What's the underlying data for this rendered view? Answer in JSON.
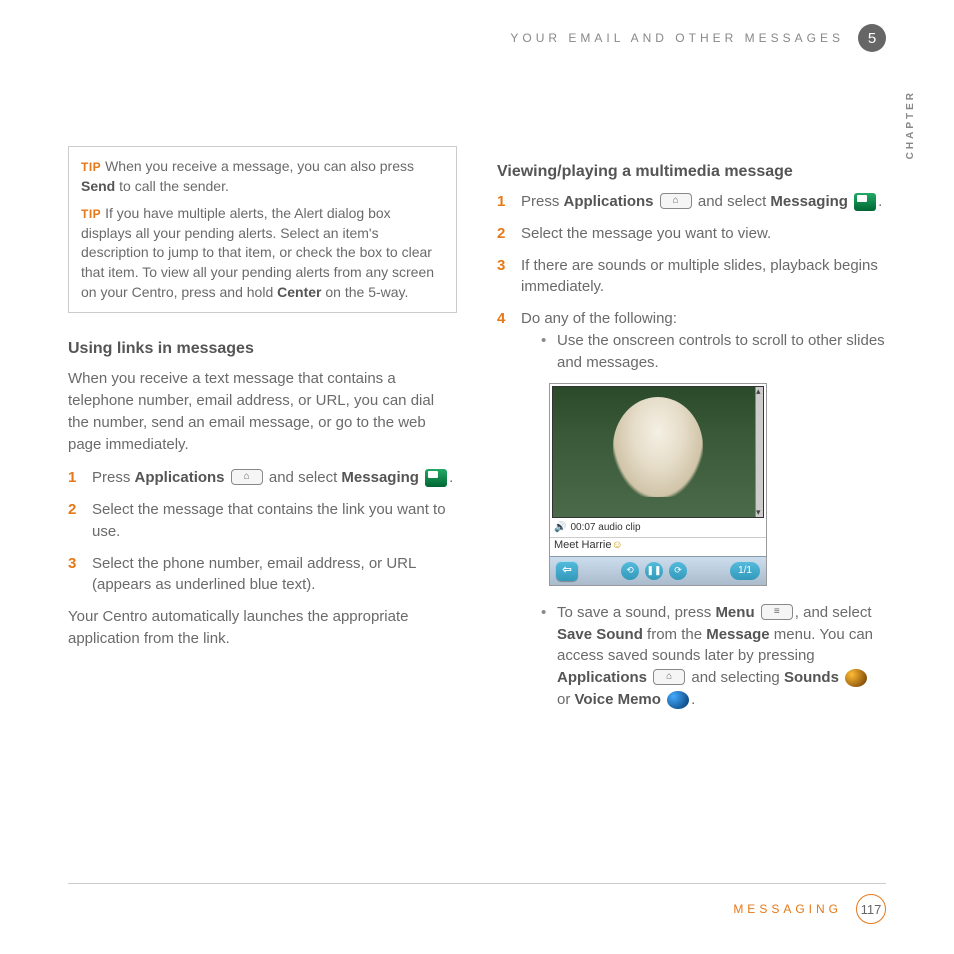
{
  "header": {
    "title": "YOUR EMAIL AND OTHER MESSAGES",
    "chapter_number": "5",
    "chapter_label": "CHAPTER"
  },
  "tips": {
    "label": "TIP",
    "tip1_a": "When you receive a message, you can also press ",
    "tip1_bold": "Send",
    "tip1_b": " to call the sender.",
    "tip2_a": "If you have multiple alerts, the Alert dialog box displays all your pending alerts. Select an item's description to jump to that item, or check the box to clear that item. To view all your pending alerts from any screen on your Centro, press and hold ",
    "tip2_bold": "Center",
    "tip2_b": " on the 5-way."
  },
  "left": {
    "section_title": "Using links in messages",
    "intro": "When you receive a text message that contains a telephone number, email address, or URL, you can dial the number, send an email message, or go to the web page immediately.",
    "step1_a": "Press ",
    "step1_b1": "Applications",
    "step1_c": " and select ",
    "step1_b2": "Messaging",
    "step1_d": ".",
    "step2": "Select the message that contains the link you want to use.",
    "step3": "Select the phone number, email address, or URL (appears as underlined blue text).",
    "outro": "Your Centro automatically launches the appropriate application from the link."
  },
  "right": {
    "section_title": "Viewing/playing a multimedia message",
    "step1_a": "Press ",
    "step1_b1": "Applications",
    "step1_c": " and select ",
    "step1_b2": "Messaging",
    "step1_d": ".",
    "step2": "Select the message you want to view.",
    "step3": "If there are sounds or multiple slides, playback begins immediately.",
    "step4": "Do any of the following:",
    "bullet1": "Use the onscreen controls to scroll to other slides and messages.",
    "bullet2_a": "To save a sound, press ",
    "bullet2_b1": "Menu",
    "bullet2_b": ", and select ",
    "bullet2_b2": "Save Sound",
    "bullet2_c": " from the ",
    "bullet2_b3": "Message",
    "bullet2_d": " menu. You can access saved sounds later by pressing ",
    "bullet2_b4": "Applications",
    "bullet2_e": " and selecting ",
    "bullet2_b5": "Sounds",
    "bullet2_f": " or ",
    "bullet2_b6": "Voice Memo",
    "bullet2_g": "."
  },
  "screenshot": {
    "audio_meta": "00:07 audio clip",
    "caption": "Meet Harrie",
    "counter": "1/1"
  },
  "footer": {
    "label": "MESSAGING",
    "page": "117"
  }
}
